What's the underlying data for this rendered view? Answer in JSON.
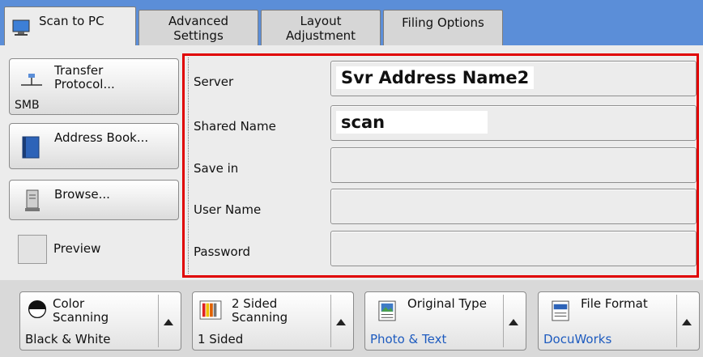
{
  "tabs": [
    {
      "label": "Scan to PC",
      "active": true,
      "icon": "monitor-icon"
    },
    {
      "label": "Advanced\nSettings"
    },
    {
      "label": "Layout\nAdjustment"
    },
    {
      "label": "Filing Options"
    }
  ],
  "left": {
    "transfer_protocol": {
      "label": "Transfer\nProtocol...",
      "value": "SMB",
      "icon": "network-icon"
    },
    "address_book": {
      "label": "Address Book...",
      "icon": "book-icon"
    },
    "browse": {
      "label": "Browse...",
      "icon": "server-icon"
    },
    "preview": {
      "label": "Preview",
      "checked": false
    }
  },
  "form": {
    "server": {
      "label": "Server",
      "value": "Svr Address Name2"
    },
    "shared_name": {
      "label": "Shared Name",
      "value": "scan"
    },
    "save_in": {
      "label": "Save in",
      "value": ""
    },
    "user_name": {
      "label": "User Name",
      "value": ""
    },
    "password": {
      "label": "Password",
      "value": ""
    }
  },
  "bottom": {
    "color_scanning": {
      "label": "Color\nScanning",
      "value": "Black & White",
      "icon": "color-half-circle-icon"
    },
    "two_sided": {
      "label": "2 Sided\nScanning",
      "value": "1 Sided",
      "icon": "color-bars-icon"
    },
    "original_type": {
      "label": "Original Type",
      "value": "Photo & Text",
      "icon": "photo-page-icon"
    },
    "file_format": {
      "label": "File Format",
      "value": "DocuWorks",
      "icon": "xdw-file-icon"
    }
  },
  "colors": {
    "accent": "#5b8ed8",
    "highlight_border": "#e00000",
    "value_blue": "#1e5bbf"
  }
}
